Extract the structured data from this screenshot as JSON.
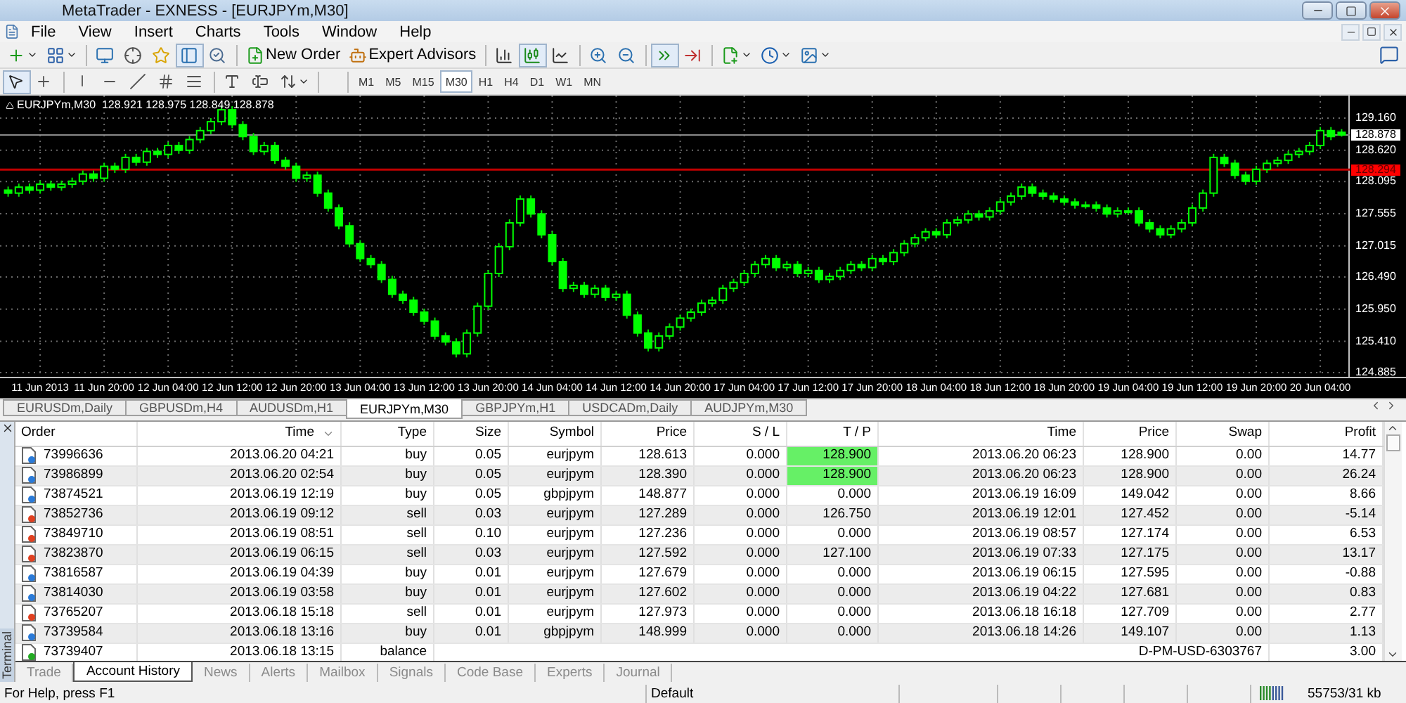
{
  "window": {
    "title": "MetaTrader - EXNESS - [EURJPYm,M30]"
  },
  "menu": [
    "File",
    "View",
    "Insert",
    "Charts",
    "Tools",
    "Window",
    "Help"
  ],
  "toolbar": [
    {
      "kind": "tool",
      "pressed": false
    },
    {
      "kind": "tool",
      "pressed": false
    },
    {
      "kind": "separator"
    },
    {
      "kind": "tool",
      "pressed": false
    },
    {
      "kind": "tool",
      "pressed": false
    },
    {
      "kind": "tool",
      "pressed": false
    },
    {
      "kind": "tool",
      "pressed": true
    },
    {
      "kind": "tool",
      "pressed": false
    },
    {
      "kind": "separator"
    },
    {
      "kind": "button",
      "label": "New Order"
    },
    {
      "kind": "button",
      "label": "Expert Advisors"
    },
    {
      "kind": "separator"
    },
    {
      "kind": "tool",
      "pressed": false
    },
    {
      "kind": "tool",
      "pressed": true
    },
    {
      "kind": "tool",
      "pressed": false
    },
    {
      "kind": "separator"
    },
    {
      "kind": "tool",
      "pressed": false
    },
    {
      "kind": "tool",
      "pressed": false
    },
    {
      "kind": "separator"
    },
    {
      "kind": "tool",
      "pressed": true
    },
    {
      "kind": "tool",
      "pressed": false
    },
    {
      "kind": "separator"
    },
    {
      "kind": "tool",
      "pressed": false
    },
    {
      "kind": "tool",
      "pressed": false
    },
    {
      "kind": "tool",
      "pressed": false
    }
  ],
  "drawing_toolbar": [
    {
      "pressed": true
    },
    {
      "pressed": false
    },
    {
      "pressed": false
    },
    {
      "pressed": false
    },
    {
      "pressed": false
    },
    {
      "pressed": false
    },
    {
      "pressed": false
    },
    {
      "pressed": false
    },
    {
      "pressed": false
    },
    {
      "pressed": false
    }
  ],
  "periods": [
    {
      "label": "M1",
      "selected": false
    },
    {
      "label": "M5",
      "selected": false
    },
    {
      "label": "M15",
      "selected": false
    },
    {
      "label": "M30",
      "selected": true
    },
    {
      "label": "H1",
      "selected": false
    },
    {
      "label": "H4",
      "selected": false
    },
    {
      "label": "D1",
      "selected": false
    },
    {
      "label": "W1",
      "selected": false
    },
    {
      "label": "MN",
      "selected": false
    }
  ],
  "chart": {
    "title": "EURJPYm,M30",
    "ohlc_text": "128.921 128.975 128.849 128.878",
    "chart_data": {
      "type": "candlestick",
      "categories": [
        null,
        null,
        null,
        "11 Jun 2013",
        null,
        null,
        null,
        null,
        null,
        "11 Jun 20:00",
        null,
        null,
        null,
        null,
        null,
        "12 Jun 04:00",
        null,
        null,
        null,
        null,
        null,
        "12 Jun 12:00",
        null,
        null,
        null,
        null,
        null,
        "12 Jun 20:00",
        null,
        null,
        null,
        null,
        null,
        "13 Jun 04:00",
        null,
        null,
        null,
        null,
        null,
        "13 Jun 12:00",
        null,
        null,
        null,
        null,
        null,
        "13 Jun 20:00",
        null,
        null,
        null,
        null,
        null,
        "14 Jun 04:00",
        null,
        null,
        null,
        null,
        null,
        "14 Jun 12:00",
        null,
        null,
        null,
        null,
        null,
        "14 Jun 20:00",
        null,
        null,
        null,
        null,
        null,
        "17 Jun 04:00",
        null,
        null,
        null,
        null,
        null,
        "17 Jun 12:00",
        null,
        null,
        null,
        null,
        null,
        "17 Jun 20:00",
        null,
        null,
        null,
        null,
        null,
        "18 Jun 04:00",
        null,
        null,
        null,
        null,
        null,
        "18 Jun 12:00",
        null,
        null,
        null,
        null,
        null,
        "18 Jun 20:00",
        null,
        null,
        null,
        null,
        null,
        "19 Jun 04:00",
        null,
        null,
        null,
        null,
        null,
        "19 Jun 12:00",
        null,
        null,
        null,
        null,
        null,
        "19 Jun 20:00",
        null,
        null,
        null,
        null,
        null,
        "20 Jun 04:00",
        null,
        null
      ],
      "grid": true,
      "ohlc": [
        [
          127.95,
          128.01,
          127.84,
          127.9
        ],
        [
          127.9,
          128.06,
          127.84,
          128.0
        ],
        [
          128.0,
          128.06,
          127.89,
          127.95
        ],
        [
          127.95,
          128.11,
          127.89,
          128.05
        ],
        [
          128.05,
          128.11,
          127.94,
          128.0
        ],
        [
          128.0,
          128.11,
          127.94,
          128.05
        ],
        [
          128.05,
          128.16,
          127.99,
          128.1
        ],
        [
          128.1,
          128.28,
          128.04,
          128.22
        ],
        [
          128.22,
          128.28,
          128.09,
          128.15
        ],
        [
          128.15,
          128.41,
          128.09,
          128.35
        ],
        [
          128.35,
          128.41,
          128.24,
          128.3
        ],
        [
          128.3,
          128.56,
          128.24,
          128.5
        ],
        [
          128.5,
          128.56,
          128.36,
          128.42
        ],
        [
          128.42,
          128.66,
          128.36,
          128.6
        ],
        [
          128.6,
          128.66,
          128.49,
          128.55
        ],
        [
          128.55,
          128.76,
          128.49,
          128.7
        ],
        [
          128.7,
          128.76,
          128.56,
          128.62
        ],
        [
          128.62,
          128.86,
          128.56,
          128.8
        ],
        [
          128.8,
          129.01,
          128.74,
          128.95
        ],
        [
          128.95,
          129.16,
          128.89,
          129.1
        ],
        [
          129.1,
          129.36,
          129.04,
          129.3
        ],
        [
          129.3,
          129.36,
          128.99,
          129.05
        ],
        [
          129.05,
          129.11,
          128.79,
          128.85
        ],
        [
          128.85,
          128.91,
          128.54,
          128.6
        ],
        [
          128.6,
          128.76,
          128.54,
          128.7
        ],
        [
          128.7,
          128.76,
          128.39,
          128.45
        ],
        [
          128.45,
          128.51,
          128.29,
          128.35
        ],
        [
          128.35,
          128.41,
          128.09,
          128.15
        ],
        [
          128.15,
          128.26,
          128.09,
          128.2
        ],
        [
          128.2,
          128.26,
          127.84,
          127.9
        ],
        [
          127.9,
          127.96,
          127.59,
          127.65
        ],
        [
          127.65,
          127.71,
          127.29,
          127.35
        ],
        [
          127.35,
          127.41,
          126.99,
          127.05
        ],
        [
          127.05,
          127.11,
          126.74,
          126.8
        ],
        [
          126.8,
          126.86,
          126.64,
          126.7
        ],
        [
          126.7,
          126.76,
          126.39,
          126.45
        ],
        [
          126.45,
          126.51,
          126.14,
          126.2
        ],
        [
          126.2,
          126.26,
          126.04,
          126.1
        ],
        [
          126.1,
          126.16,
          125.84,
          125.9
        ],
        [
          125.9,
          125.96,
          125.69,
          125.75
        ],
        [
          125.75,
          125.81,
          125.44,
          125.5
        ],
        [
          125.5,
          125.56,
          125.34,
          125.4
        ],
        [
          125.4,
          125.46,
          125.14,
          125.2
        ],
        [
          125.2,
          125.61,
          125.14,
          125.55
        ],
        [
          125.55,
          126.06,
          125.49,
          126.0
        ],
        [
          126.0,
          126.61,
          125.94,
          126.55
        ],
        [
          126.55,
          127.06,
          126.49,
          127.0
        ],
        [
          127.0,
          127.46,
          126.94,
          127.4
        ],
        [
          127.4,
          127.86,
          127.34,
          127.8
        ],
        [
          127.8,
          127.86,
          127.49,
          127.55
        ],
        [
          127.55,
          127.61,
          127.14,
          127.2
        ],
        [
          127.2,
          127.26,
          126.69,
          126.75
        ],
        [
          126.75,
          126.81,
          126.24,
          126.3
        ],
        [
          126.3,
          126.41,
          126.24,
          126.35
        ],
        [
          126.35,
          126.41,
          126.14,
          126.2
        ],
        [
          126.2,
          126.36,
          126.14,
          126.3
        ],
        [
          126.3,
          126.36,
          126.09,
          126.15
        ],
        [
          126.15,
          126.26,
          126.09,
          126.2
        ],
        [
          126.2,
          126.26,
          125.79,
          125.85
        ],
        [
          125.85,
          125.91,
          125.49,
          125.55
        ],
        [
          125.55,
          125.61,
          125.24,
          125.3
        ],
        [
          125.3,
          125.56,
          125.24,
          125.5
        ],
        [
          125.5,
          125.71,
          125.44,
          125.65
        ],
        [
          125.65,
          125.86,
          125.59,
          125.8
        ],
        [
          125.8,
          125.96,
          125.74,
          125.9
        ],
        [
          125.9,
          126.11,
          125.84,
          126.05
        ],
        [
          126.05,
          126.16,
          125.99,
          126.1
        ],
        [
          126.1,
          126.36,
          126.04,
          126.3
        ],
        [
          126.3,
          126.46,
          126.24,
          126.4
        ],
        [
          126.4,
          126.61,
          126.34,
          126.55
        ],
        [
          126.55,
          126.76,
          126.49,
          126.7
        ],
        [
          126.7,
          126.86,
          126.64,
          126.8
        ],
        [
          126.8,
          126.86,
          126.59,
          126.65
        ],
        [
          126.65,
          126.76,
          126.59,
          126.7
        ],
        [
          126.7,
          126.76,
          126.49,
          126.55
        ],
        [
          126.55,
          126.66,
          126.49,
          126.6
        ],
        [
          126.6,
          126.66,
          126.39,
          126.45
        ],
        [
          126.45,
          126.56,
          126.39,
          126.5
        ],
        [
          126.5,
          126.66,
          126.44,
          126.6
        ],
        [
          126.6,
          126.76,
          126.54,
          126.7
        ],
        [
          126.7,
          126.76,
          126.59,
          126.65
        ],
        [
          126.65,
          126.86,
          126.59,
          126.8
        ],
        [
          126.8,
          126.86,
          126.69,
          126.75
        ],
        [
          126.75,
          126.96,
          126.69,
          126.9
        ],
        [
          126.9,
          127.11,
          126.84,
          127.05
        ],
        [
          127.05,
          127.21,
          126.99,
          127.15
        ],
        [
          127.15,
          127.31,
          127.09,
          127.25
        ],
        [
          127.25,
          127.31,
          127.14,
          127.2
        ],
        [
          127.2,
          127.46,
          127.14,
          127.4
        ],
        [
          127.4,
          127.51,
          127.34,
          127.45
        ],
        [
          127.45,
          127.61,
          127.39,
          127.55
        ],
        [
          127.55,
          127.61,
          127.44,
          127.5
        ],
        [
          127.5,
          127.66,
          127.44,
          127.6
        ],
        [
          127.6,
          127.81,
          127.54,
          127.75
        ],
        [
          127.75,
          127.91,
          127.69,
          127.85
        ],
        [
          127.85,
          128.06,
          127.79,
          128.0
        ],
        [
          128.0,
          128.06,
          127.84,
          127.9
        ],
        [
          127.9,
          127.96,
          127.79,
          127.85
        ],
        [
          127.85,
          127.91,
          127.74,
          127.8
        ],
        [
          127.8,
          127.86,
          127.69,
          127.75
        ],
        [
          127.75,
          127.81,
          127.64,
          127.7
        ],
        [
          127.7,
          127.76,
          127.64,
          127.7
        ],
        [
          127.7,
          127.76,
          127.59,
          127.65
        ],
        [
          127.65,
          127.71,
          127.49,
          127.55
        ],
        [
          127.55,
          127.66,
          127.49,
          127.6
        ],
        [
          127.6,
          127.66,
          127.54,
          127.6
        ],
        [
          127.6,
          127.66,
          127.34,
          127.4
        ],
        [
          127.4,
          127.46,
          127.24,
          127.3
        ],
        [
          127.3,
          127.36,
          127.14,
          127.2
        ],
        [
          127.2,
          127.36,
          127.14,
          127.3
        ],
        [
          127.3,
          127.46,
          127.24,
          127.4
        ],
        [
          127.4,
          127.71,
          127.34,
          127.65
        ],
        [
          127.65,
          127.96,
          127.59,
          127.9
        ],
        [
          127.9,
          128.56,
          127.84,
          128.5
        ],
        [
          128.5,
          128.56,
          128.34,
          128.4
        ],
        [
          128.4,
          128.46,
          128.14,
          128.2
        ],
        [
          128.2,
          128.26,
          128.04,
          128.1
        ],
        [
          128.1,
          128.36,
          128.04,
          128.3
        ],
        [
          128.3,
          128.46,
          128.24,
          128.4
        ],
        [
          128.4,
          128.51,
          128.34,
          128.45
        ],
        [
          128.45,
          128.61,
          128.39,
          128.55
        ],
        [
          128.55,
          128.66,
          128.49,
          128.6
        ],
        [
          128.6,
          128.76,
          128.54,
          128.7
        ],
        [
          128.7,
          129.01,
          128.64,
          128.95
        ],
        [
          128.95,
          129.01,
          128.79,
          128.85
        ],
        [
          128.921,
          128.975,
          128.849,
          128.878
        ]
      ],
      "ylim": [
        124.814,
        129.538
      ],
      "yticks": [
        {
          "value": 129.16,
          "label": "129.160"
        },
        {
          "value": 128.62,
          "label": "128.620"
        },
        {
          "value": 128.095,
          "label": "128.095"
        },
        {
          "value": 127.555,
          "label": "127.555"
        },
        {
          "value": 127.015,
          "label": "127.015"
        },
        {
          "value": 126.49,
          "label": "126.490"
        },
        {
          "value": 125.95,
          "label": "125.950"
        },
        {
          "value": 125.41,
          "label": "125.410"
        },
        {
          "value": 124.885,
          "label": "124.885"
        }
      ],
      "ref_lines": [
        {
          "axis": "y",
          "value": 128.878,
          "label": "128.878",
          "color": "#8a8a8a"
        },
        {
          "axis": "y",
          "value": 128.294,
          "label": "128.294",
          "color": "#c00000"
        }
      ]
    }
  },
  "chart_tabs": [
    {
      "label": "EURUSDm,Daily",
      "selected": false
    },
    {
      "label": "GBPUSDm,H4",
      "selected": false
    },
    {
      "label": "AUDUSDm,H1",
      "selected": false
    },
    {
      "label": "EURJPYm,M30",
      "selected": true
    },
    {
      "label": "GBPJPYm,H1",
      "selected": false
    },
    {
      "label": "USDCADm,Daily",
      "selected": false
    },
    {
      "label": "AUDJPYm,M30",
      "selected": false
    }
  ],
  "terminal": {
    "title": "Terminal",
    "columns": [
      "Order",
      "Time",
      "Type",
      "Size",
      "Symbol",
      "Price",
      "S / L",
      "T / P",
      "Time",
      "Price",
      "Swap",
      "Profit"
    ],
    "rows": [
      {
        "kind": "buy",
        "order": "73996636",
        "time": "2013.06.20 04:21",
        "type": "buy",
        "size": "0.05",
        "symbol": "eurjpym",
        "price": "128.613",
        "sl": "0.000",
        "tp": "128.900",
        "tp_hit": true,
        "close_time": "2013.06.20 06:23",
        "close_price": "128.900",
        "swap": "0.00",
        "profit": "14.77"
      },
      {
        "kind": "buy",
        "order": "73986899",
        "time": "2013.06.20 02:54",
        "type": "buy",
        "size": "0.05",
        "symbol": "eurjpym",
        "price": "128.390",
        "sl": "0.000",
        "tp": "128.900",
        "tp_hit": true,
        "close_time": "2013.06.20 06:23",
        "close_price": "128.900",
        "swap": "0.00",
        "profit": "26.24"
      },
      {
        "kind": "buy",
        "order": "73874521",
        "time": "2013.06.19 12:19",
        "type": "buy",
        "size": "0.05",
        "symbol": "gbpjpym",
        "price": "148.877",
        "sl": "0.000",
        "tp": "0.000",
        "tp_hit": false,
        "close_time": "2013.06.19 16:09",
        "close_price": "149.042",
        "swap": "0.00",
        "profit": "8.66"
      },
      {
        "kind": "sell",
        "order": "73852736",
        "time": "2013.06.19 09:12",
        "type": "sell",
        "size": "0.03",
        "symbol": "eurjpym",
        "price": "127.289",
        "sl": "0.000",
        "tp": "126.750",
        "tp_hit": false,
        "close_time": "2013.06.19 12:01",
        "close_price": "127.452",
        "swap": "0.00",
        "profit": "-5.14"
      },
      {
        "kind": "sell",
        "order": "73849710",
        "time": "2013.06.19 08:51",
        "type": "sell",
        "size": "0.10",
        "symbol": "eurjpym",
        "price": "127.236",
        "sl": "0.000",
        "tp": "0.000",
        "tp_hit": false,
        "close_time": "2013.06.19 08:57",
        "close_price": "127.174",
        "swap": "0.00",
        "profit": "6.53"
      },
      {
        "kind": "sell",
        "order": "73823870",
        "time": "2013.06.19 06:15",
        "type": "sell",
        "size": "0.03",
        "symbol": "eurjpym",
        "price": "127.592",
        "sl": "0.000",
        "tp": "127.100",
        "tp_hit": false,
        "close_time": "2013.06.19 07:33",
        "close_price": "127.175",
        "swap": "0.00",
        "profit": "13.17"
      },
      {
        "kind": "buy",
        "order": "73816587",
        "time": "2013.06.19 04:39",
        "type": "buy",
        "size": "0.01",
        "symbol": "eurjpym",
        "price": "127.679",
        "sl": "0.000",
        "tp": "0.000",
        "tp_hit": false,
        "close_time": "2013.06.19 06:15",
        "close_price": "127.595",
        "swap": "0.00",
        "profit": "-0.88"
      },
      {
        "kind": "buy",
        "order": "73814030",
        "time": "2013.06.19 03:58",
        "type": "buy",
        "size": "0.01",
        "symbol": "eurjpym",
        "price": "127.602",
        "sl": "0.000",
        "tp": "0.000",
        "tp_hit": false,
        "close_time": "2013.06.19 04:22",
        "close_price": "127.681",
        "swap": "0.00",
        "profit": "0.83"
      },
      {
        "kind": "sell",
        "order": "73765207",
        "time": "2013.06.18 15:18",
        "type": "sell",
        "size": "0.01",
        "symbol": "eurjpym",
        "price": "127.973",
        "sl": "0.000",
        "tp": "0.000",
        "tp_hit": false,
        "close_time": "2013.06.18 16:18",
        "close_price": "127.709",
        "swap": "0.00",
        "profit": "2.77"
      },
      {
        "kind": "buy",
        "order": "73739584",
        "time": "2013.06.18 13:16",
        "type": "buy",
        "size": "0.01",
        "symbol": "gbpjpym",
        "price": "148.999",
        "sl": "0.000",
        "tp": "0.000",
        "tp_hit": false,
        "close_time": "2013.06.18 14:26",
        "close_price": "149.107",
        "swap": "0.00",
        "profit": "1.13"
      },
      {
        "kind": "balance",
        "order": "73739407",
        "time": "2013.06.18 13:15",
        "type": "balance",
        "comment": "D-PM-USD-6303767",
        "profit": "3.00"
      }
    ],
    "tabs": [
      {
        "label": "Trade",
        "selected": false
      },
      {
        "label": "Account History",
        "selected": true
      },
      {
        "label": "News",
        "selected": false
      },
      {
        "label": "Alerts",
        "selected": false
      },
      {
        "label": "Mailbox",
        "selected": false
      },
      {
        "label": "Signals",
        "selected": false
      },
      {
        "label": "Code Base",
        "selected": false
      },
      {
        "label": "Experts",
        "selected": false
      },
      {
        "label": "Journal",
        "selected": false
      }
    ]
  },
  "status_bar": {
    "help": "For Help, press F1",
    "profile": "Default",
    "traffic": "55753/31 kb"
  }
}
